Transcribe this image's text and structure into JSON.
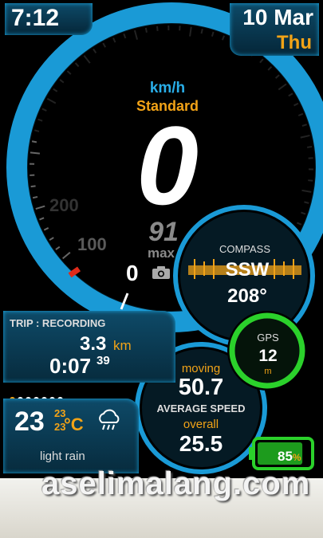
{
  "header": {
    "time": "7:12",
    "date": "10 Mar",
    "day": "Thu"
  },
  "speedometer": {
    "unit": "km/h",
    "mode": "Standard",
    "speed": "0",
    "max_value": "91",
    "max_label": "max",
    "reset_value": "0",
    "tick_labels": [
      "100",
      "200"
    ],
    "camera_icon": "camera-icon"
  },
  "compass": {
    "title": "COMPASS",
    "direction": "SSW",
    "degrees": "208°"
  },
  "gps": {
    "title": "GPS",
    "value": "12",
    "unit": "m"
  },
  "trip": {
    "title": "TRIP : RECORDING",
    "distance": "3.3",
    "distance_unit": "km",
    "time": "0:07",
    "seconds": "39"
  },
  "weather": {
    "temperature": "23",
    "high": "23",
    "low": "23",
    "unit": "°C",
    "condition": "light rain",
    "icon": "rain-cloud-icon",
    "page_dots": 7,
    "active_dot": 0
  },
  "average_speed": {
    "title": "AVERAGE SPEED",
    "moving_label": "moving",
    "moving_value": "50.7",
    "overall_label": "overall",
    "overall_value": "25.5"
  },
  "battery": {
    "level": 85,
    "percent_text": "85",
    "percent_symbol": "%"
  },
  "watermark": {
    "text": "aselimalang.com"
  },
  "colors": {
    "accent_blue": "#29aee8",
    "accent_orange": "#f2a317",
    "gps_green": "#2bd12b",
    "battery_green": "#2bd12b",
    "panel_dark": "#072b3d"
  }
}
